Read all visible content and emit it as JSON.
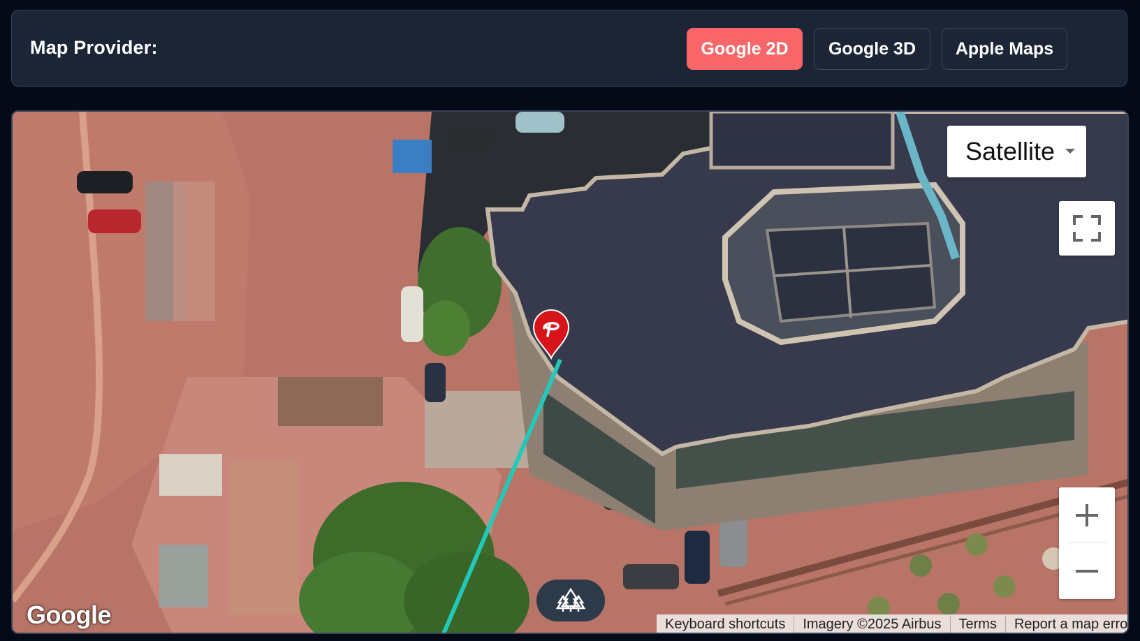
{
  "header": {
    "label": "Map Provider:",
    "providers": [
      {
        "label": "Google 2D",
        "active": true
      },
      {
        "label": "Google 3D",
        "active": false
      },
      {
        "label": "Apple Maps",
        "active": false
      }
    ],
    "active_color": "#f8666a"
  },
  "map": {
    "map_type_label": "Satellite",
    "logo_text": "Google",
    "attribution": {
      "shortcuts": "Keyboard shortcuts",
      "imagery": "Imagery ©2025 Airbus",
      "terms": "Terms",
      "report": "Report a map error"
    },
    "controls": {
      "fullscreen_icon": "fullscreen-icon",
      "zoom_in_icon": "plus-icon",
      "zoom_out_icon": "minus-icon",
      "nearby_icon": "trees-icon"
    },
    "marker": {
      "icon": "location-pin-icon",
      "color": "#d8141b"
    },
    "route_color": "#22c9b8"
  }
}
